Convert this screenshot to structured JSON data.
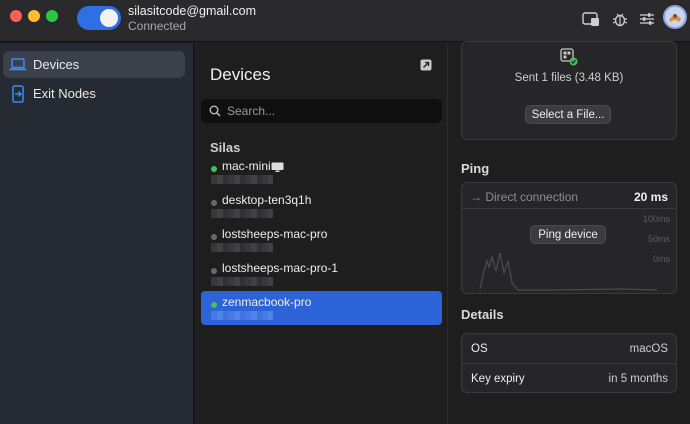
{
  "account": {
    "email": "silasitcode@gmail.com",
    "status": "Connected"
  },
  "sidebar": {
    "items": [
      {
        "label": "Devices",
        "icon": "laptop-icon",
        "active": true
      },
      {
        "label": "Exit Nodes",
        "icon": "exit-node-icon",
        "active": false
      }
    ]
  },
  "device_list": {
    "title": "Devices",
    "search_placeholder": "Search...",
    "group": "Silas",
    "devices": [
      {
        "name": "mac-mini",
        "online": true,
        "selected": false
      },
      {
        "name": "desktop-ten3q1h",
        "online": false,
        "selected": false
      },
      {
        "name": "lostsheeps-mac-pro",
        "online": false,
        "selected": false
      },
      {
        "name": "lostsheeps-mac-pro-1",
        "online": false,
        "selected": false
      },
      {
        "name": "zenmacbook-pro",
        "online": true,
        "selected": true
      }
    ]
  },
  "file_transfer": {
    "sent_text": "Sent 1 files (3.48 KB)",
    "select_button": "Select a File..."
  },
  "ping": {
    "title": "Ping",
    "connection": "→ Direct connection",
    "latency": "20 ms",
    "button": "Ping device",
    "axis_labels": [
      "100ms",
      "50ms",
      "0ms"
    ]
  },
  "details": {
    "title": "Details",
    "rows": [
      {
        "key": "OS",
        "value": "macOS"
      },
      {
        "key": "Key expiry",
        "value": "in 5 months"
      }
    ]
  },
  "colors": {
    "accent": "#2c63d6",
    "online": "#3ec45a",
    "offline": "#6a6a6a",
    "toggle": "#2f6fe4"
  }
}
